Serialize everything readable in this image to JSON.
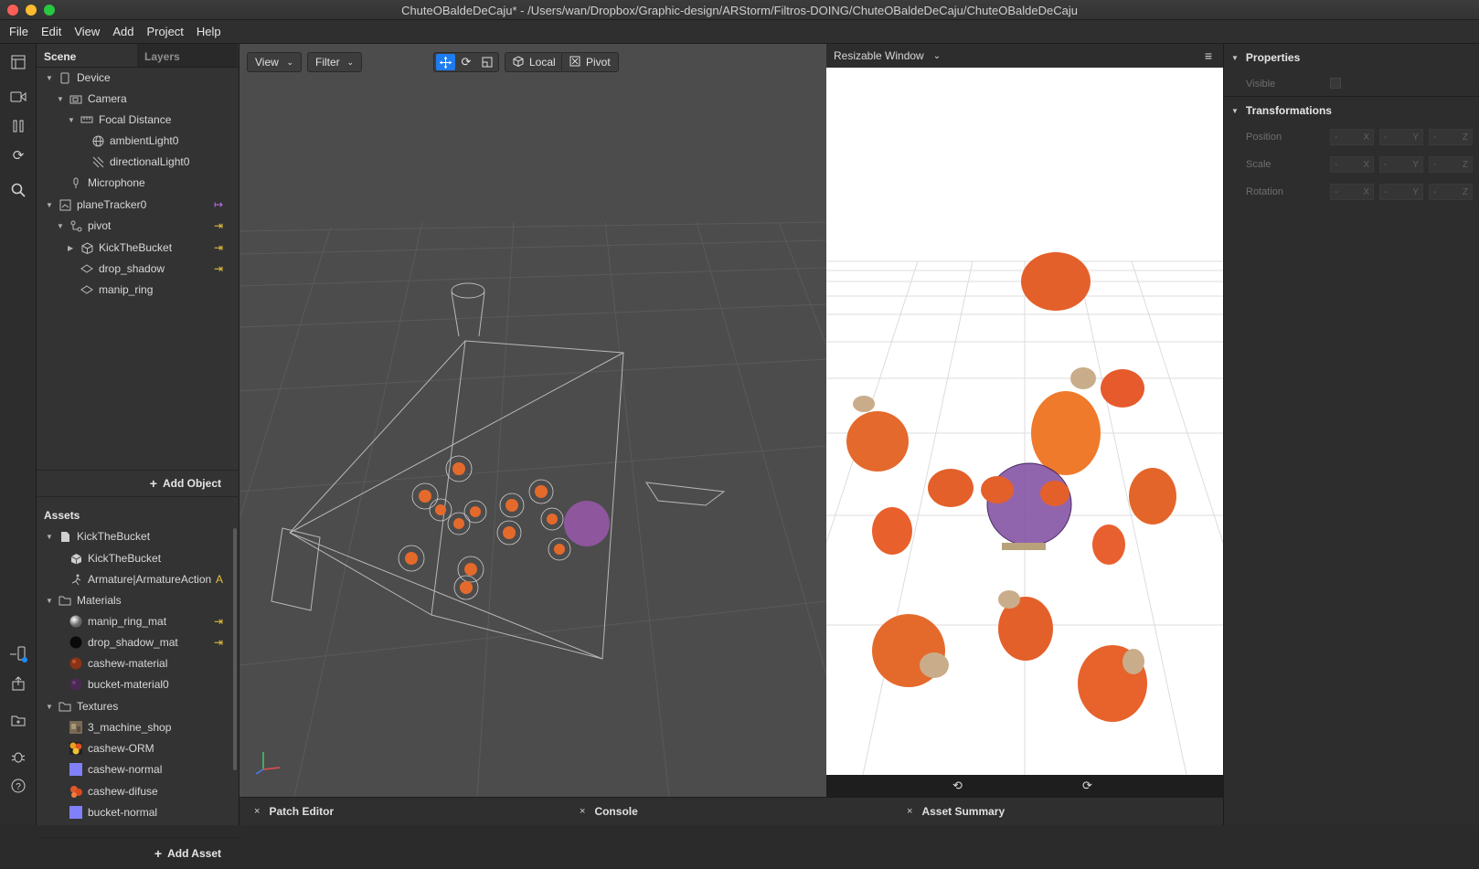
{
  "window": {
    "title": "ChuteOBaldeDeCaju* - /Users/wan/Dropbox/Graphic-design/ARStorm/Filtros-DOING/ChuteOBaldeDeCaju/ChuteOBaldeDeCaju",
    "traffic_lights": [
      "#fd5f57",
      "#febc2e",
      "#28c840"
    ]
  },
  "menu": [
    "File",
    "Edit",
    "View",
    "Add",
    "Project",
    "Help"
  ],
  "scene_panel": {
    "tabs": [
      "Scene",
      "Layers"
    ],
    "tree": [
      {
        "label": "Device",
        "icon": "device-icon",
        "arrow": ""
      },
      {
        "label": "Camera",
        "icon": "camera-icon",
        "arrow": ""
      },
      {
        "label": "Focal Distance",
        "icon": "focal-distance-icon",
        "arrow": ""
      },
      {
        "label": "ambientLight0",
        "icon": "globe-icon",
        "arrow": ""
      },
      {
        "label": "directionalLight0",
        "icon": "directional-light-icon",
        "arrow": ""
      },
      {
        "label": "Microphone",
        "icon": "microphone-icon",
        "arrow": ""
      },
      {
        "label": "planeTracker0",
        "icon": "plane-tracker-icon",
        "arrow": "↦"
      },
      {
        "label": "pivot",
        "icon": "null-object-icon",
        "arrow": "⇥"
      },
      {
        "label": "KickTheBucket",
        "icon": "cube-icon",
        "arrow": "⇥"
      },
      {
        "label": "drop_shadow",
        "icon": "plane-icon",
        "arrow": "⇥"
      },
      {
        "label": "manip_ring",
        "icon": "plane-icon",
        "arrow": ""
      }
    ],
    "add_object": "Add Object"
  },
  "assets_panel": {
    "title": "Assets",
    "items": [
      {
        "label": "KickTheBucket",
        "icon": "file-icon",
        "arrow": ""
      },
      {
        "label": "KickTheBucket",
        "icon": "cube-icon",
        "arrow": ""
      },
      {
        "label": "Armature|ArmatureAction",
        "icon": "animation-icon",
        "arrow": "A"
      },
      {
        "label": "Materials",
        "icon": "folder-icon",
        "arrow": ""
      },
      {
        "label": "manip_ring_mat",
        "icon": "material-grey-icon",
        "arrow": "⇥"
      },
      {
        "label": "drop_shadow_mat",
        "icon": "material-black-icon",
        "arrow": "⇥"
      },
      {
        "label": "cashew-material",
        "icon": "material-cashew-icon",
        "arrow": ""
      },
      {
        "label": "bucket-material0",
        "icon": "material-purple-icon",
        "arrow": ""
      },
      {
        "label": "Textures",
        "icon": "folder-icon",
        "arrow": ""
      },
      {
        "label": "3_machine_shop",
        "icon": "texture-photo-icon",
        "arrow": ""
      },
      {
        "label": "cashew-ORM",
        "icon": "texture-orm-icon",
        "arrow": ""
      },
      {
        "label": "cashew-normal",
        "icon": "texture-normal-icon",
        "arrow": ""
      },
      {
        "label": "cashew-difuse",
        "icon": "texture-diffuse-icon",
        "arrow": ""
      },
      {
        "label": "bucket-normal",
        "icon": "texture-normal-icon",
        "arrow": ""
      }
    ],
    "add_asset": "Add Asset"
  },
  "viewport": {
    "view_label": "View",
    "filter_label": "Filter",
    "local_label": "Local",
    "pivot_label": "Pivot"
  },
  "preview": {
    "device_label": "Resizable Window"
  },
  "bottom_tabs": [
    "Patch Editor",
    "Console",
    "Asset Summary"
  ],
  "properties": {
    "properties_title": "Properties",
    "visible_label": "Visible",
    "transformations_title": "Transformations",
    "position_label": "Position",
    "scale_label": "Scale",
    "rotation_label": "Rotation",
    "dash": "-",
    "axes": [
      "X",
      "Y",
      "Z"
    ]
  }
}
